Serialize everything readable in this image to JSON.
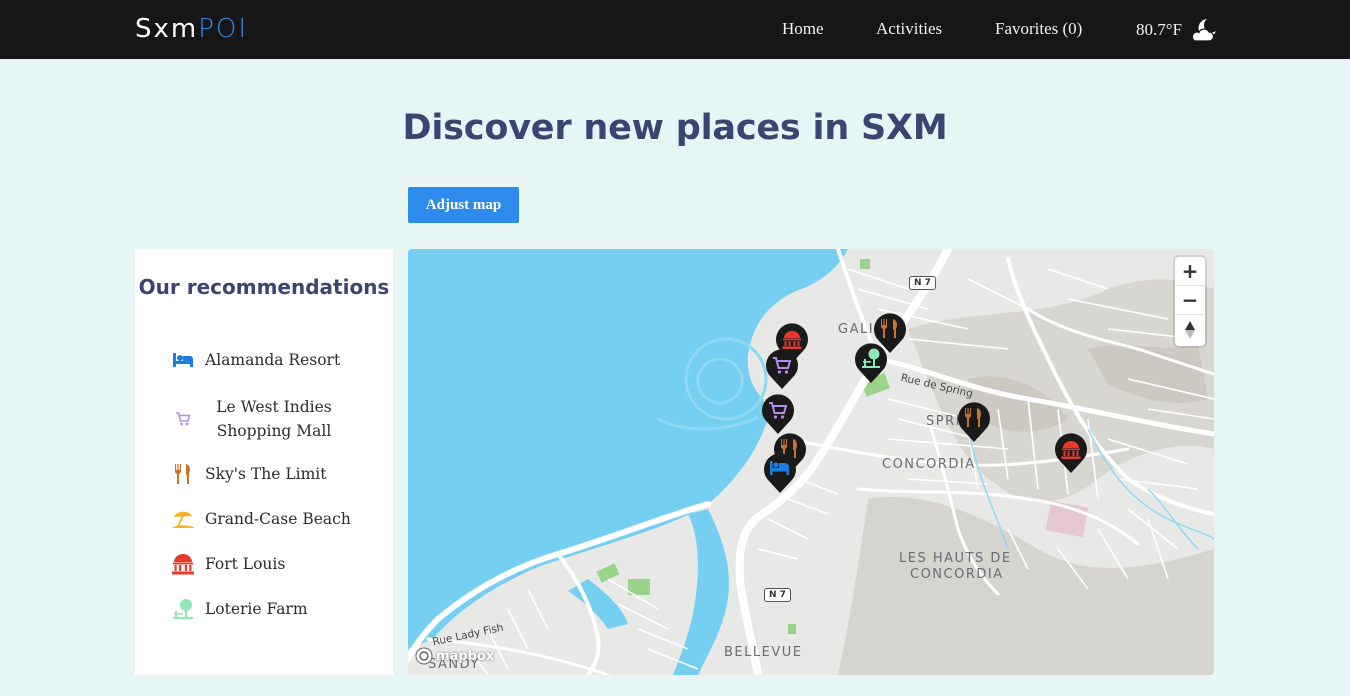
{
  "nav": {
    "logo_part1": "Sxm",
    "logo_part2": "POI",
    "home": "Home",
    "activities": "Activities",
    "favorites": "Favorites (0)",
    "temperature": "80.7°F",
    "weather_icon": "cloud-moon-icon"
  },
  "hero": {
    "title": "Discover new places in SXM",
    "adjust_button": "Adjust map"
  },
  "recommendations": {
    "title": "Our recommendations",
    "items": [
      {
        "label": "Alamanda Resort",
        "icon": "hotel-bed-icon",
        "color": "#1a7fe0"
      },
      {
        "label": "Le West Indies Shopping Mall",
        "icon": "shopping-cart-icon",
        "color": "#b88be8"
      },
      {
        "label": "Sky's The Limit",
        "icon": "restaurant-icon",
        "color": "#c8742c"
      },
      {
        "label": "Grand-Case Beach",
        "icon": "beach-umbrella-icon",
        "color": "#f4b322"
      },
      {
        "label": "Fort Louis",
        "icon": "landmark-icon",
        "color": "#e8382c"
      },
      {
        "label": "Loterie Farm",
        "icon": "park-icon",
        "color": "#8fe6b6"
      }
    ]
  },
  "map": {
    "labels": {
      "galisbay": "GALI",
      "spring": "SPRI",
      "concordia": "CONCORDIA",
      "hauts1": "LES HAUTS DE",
      "hauts2": "CONCORDIA",
      "bellevue": "BELLEVUE",
      "sandy": "SANDY",
      "rue_spring": "Rue de Spring",
      "rue_lady_fish": "Rue Lady Fish",
      "n7": "N 7"
    },
    "zoom_in": "+",
    "zoom_out": "−",
    "compass": "▲",
    "attribution": "mapbox",
    "colors": {
      "water": "#75cff0",
      "land": "#e8e8e6",
      "hill": "#d4d2cc",
      "road": "#ffffff",
      "park": "#9ad48a",
      "pin": "#1a1a1a"
    }
  }
}
